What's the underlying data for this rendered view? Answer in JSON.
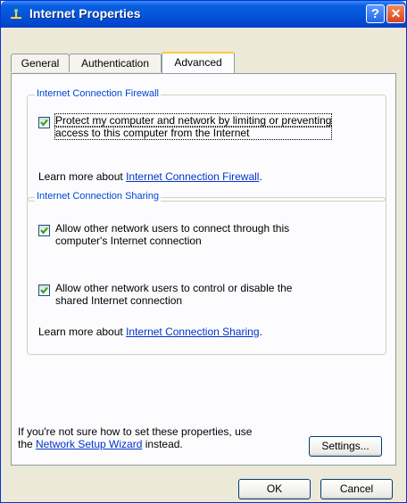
{
  "window": {
    "title": "Internet Properties"
  },
  "tabs": [
    {
      "label": "General",
      "selected": false
    },
    {
      "label": "Authentication",
      "selected": false
    },
    {
      "label": "Advanced",
      "selected": true
    }
  ],
  "firewall": {
    "title": "Internet Connection Firewall",
    "protect_line1": "Protect my computer and network by limiting or preventing",
    "protect_line2": "access to this computer from the Internet",
    "protect_checked": true,
    "learn_prefix": "Learn more about ",
    "learn_link": "Internet Connection Firewall",
    "learn_suffix": "."
  },
  "sharing": {
    "title": "Internet Connection Sharing",
    "allow_connect_line1": "Allow other network users to connect through this",
    "allow_connect_line2": "computer's Internet connection",
    "allow_connect_checked": true,
    "allow_control_line1": "Allow other network users to control or disable the",
    "allow_control_line2": "shared Internet connection",
    "allow_control_checked": true,
    "learn_prefix": "Learn more about ",
    "learn_link": "Internet Connection Sharing",
    "learn_suffix": "."
  },
  "footer": {
    "line1": "If you're not sure how to set these properties, use",
    "line2_prefix": "the ",
    "wizard_link": "Network Setup Wizard",
    "line2_suffix": " instead.",
    "settings_label": "Settings..."
  },
  "buttons": {
    "ok": "OK",
    "cancel": "Cancel"
  },
  "colors": {
    "title_bar": "#0454D8",
    "group_title": "#0046D5",
    "link": "#0033CC",
    "tab_highlight": "#FFC83C"
  }
}
